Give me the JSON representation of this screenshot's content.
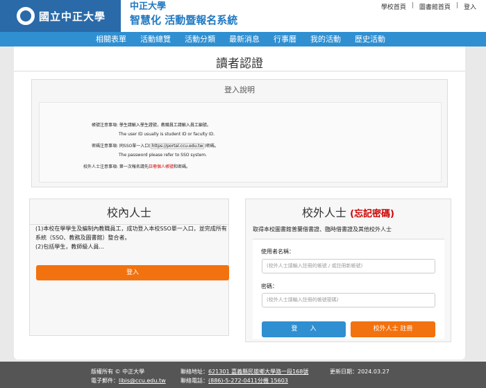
{
  "header": {
    "logo_text": "國立中正大學",
    "university": "中正大學",
    "system_title": "智慧化 活動暨報名系統",
    "top_links": [
      "學校首頁",
      "圖書館首頁",
      "登入"
    ]
  },
  "nav": {
    "items": [
      "相關表單",
      "活動總覽",
      "活動分類",
      "最新消息",
      "行事曆",
      "我的活動",
      "歷史活動"
    ]
  },
  "main": {
    "title": "讀者認證",
    "notice": {
      "heading": "登入說明",
      "account_label": "帳號注意事項:",
      "account_zh": "學生請輸入學生證號，教職員工請輸入員工編號。",
      "account_en": "The user ID usually is student ID or faculty ID.",
      "password_label": "密碼注意事項:",
      "password_zh_prefix": "同SSO單一入口(",
      "password_url": "https://portal.ccu.edu.tw",
      "password_zh_suffix": ")密碼。",
      "password_en": "The password please refer to SSO system.",
      "external_label": "校外人士注意事項:",
      "external_prefix": "第一次報名請先",
      "external_link": "註冊個人帳號",
      "external_suffix": "和密碼。"
    }
  },
  "internal": {
    "title": "校內人士",
    "line1": "(1)本校在學學生及編制內教職員工，成功登入本校SSO單一入口，並完成所有系統（SSO、教務及圖書館）整合者。",
    "line2": "(2)包括學生，教師級人員...",
    "login_label": "登入"
  },
  "external": {
    "title": "校外人士",
    "forgot_label": "(忘記密碼)",
    "description": "取得本校圖書館普蘭借書證、臨時借書證及其他校外人士",
    "username_label": "使用者名稱：",
    "username_placeholder": "(校外人士請輸入註冊的帳號 / 或註冊新帳號)",
    "password_label": "密碼：",
    "password_placeholder": "(校外人士請輸入註冊的帳號密碼)",
    "login_label": "登　　入",
    "register_label": "校外人士 註冊"
  },
  "footer": {
    "copyright": "版權所有 © 中正大學",
    "email_label": "電子郵件：",
    "email": "libis@ccu.edu.tw",
    "address_label": "聯絡地址：",
    "address": "621301 嘉義縣民雄鄉大學路一段168號",
    "phone_label": "聯絡電話：",
    "phone": "(886)-5-272-0411分機 15603",
    "updated_label": "更新日期：",
    "updated": "2024.03.27"
  },
  "colors": {
    "brand_blue": "#2a6aa8",
    "nav_blue": "#2f8fd1",
    "accent_orange": "#f2720f",
    "warning_red": "#cc0000"
  }
}
